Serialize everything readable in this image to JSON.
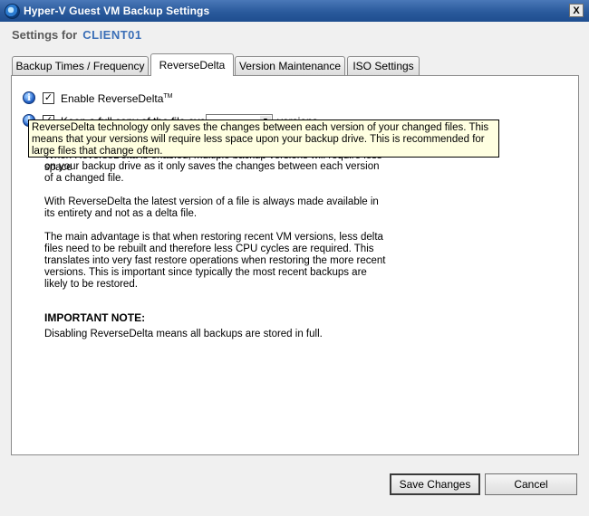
{
  "window": {
    "title": "Hyper-V Guest VM Backup Settings",
    "close_label": "X"
  },
  "heading": {
    "prefix": "Settings for",
    "client_name": "CLIENT01"
  },
  "tabs": [
    {
      "label": "Backup Times / Frequency",
      "active": false
    },
    {
      "label": "ReverseDelta",
      "active": true
    },
    {
      "label": "Version Maintenance",
      "active": false
    },
    {
      "label": "ISO Settings",
      "active": false
    }
  ],
  "options": {
    "enable_label": "Enable ReverseDelta",
    "enable_trademark": "TM",
    "enable_checked": true,
    "keep_label_visible": "Keep a full copy of the file every",
    "keep_checked": true,
    "keep_suffix": "versions"
  },
  "tooltip": {
    "text": "ReverseDelta technology only saves the changes between each version of your changed files.  This means that your versions will require less space upon your backup drive.  This is recommended for large files that change often."
  },
  "description": {
    "para1_tail": "on your backup drive as it only saves the changes between each version of a changed file.",
    "para1_head": "When ReverseDelta is enabled, multiple backup versions will require less space",
    "para2": "With ReverseDelta the latest version of a file is always made available in its entirety and not as a delta file.",
    "para3": "The main advantage is that when restoring recent VM versions, less delta files need to be rebuilt and therefore less CPU cycles are required.  This translates into very fast restore operations when restoring the more recent versions.  This is important since typically the most recent backups are likely to be restored.",
    "note_heading": "IMPORTANT NOTE:",
    "note_text": "Disabling ReverseDelta means all backups are stored in full."
  },
  "buttons": {
    "save": "Save Changes",
    "cancel": "Cancel"
  }
}
